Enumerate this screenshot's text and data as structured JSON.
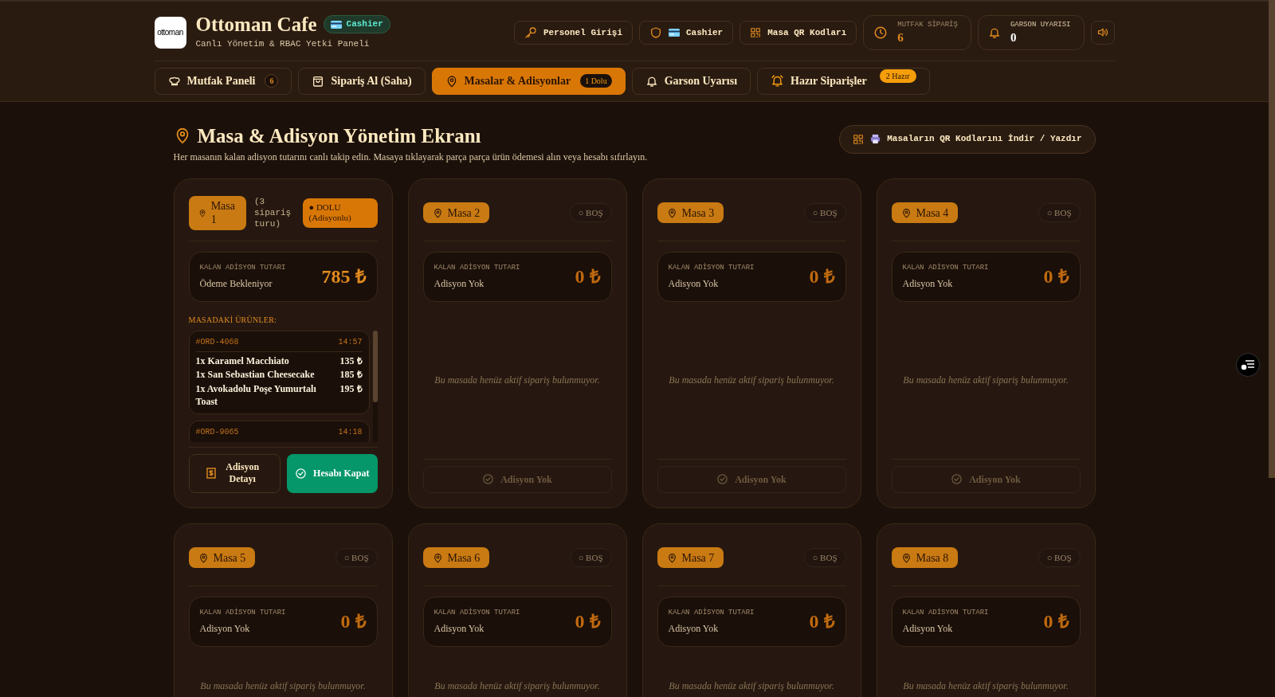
{
  "header": {
    "logo_text": "ottoman",
    "title": "Ottoman Cafe",
    "role_badge": "Cashier",
    "subtitle": "Canlı Yönetim & RBAC Yetki Paneli",
    "actions": [
      {
        "kind": "key",
        "label": "Personel Girişi"
      },
      {
        "kind": "role",
        "label": "Cashier"
      },
      {
        "kind": "qr",
        "label": "Masa QR Kodları"
      }
    ],
    "stats": [
      {
        "kind": "clock",
        "label": "MUTFAK SİPARİŞ",
        "value": "6"
      },
      {
        "kind": "bell",
        "label": "GARSON UYARISI",
        "value": "0"
      }
    ]
  },
  "tabs": [
    {
      "kind": "kitchen",
      "label": "Mutfak Paneli",
      "badge": "6",
      "selected": false
    },
    {
      "kind": "order",
      "label": "Sipariş Al (Saha)",
      "selected": false
    },
    {
      "kind": "tables",
      "label": "Masalar & Adisyonlar",
      "badge": "1 Dolu",
      "selected": true
    },
    {
      "kind": "waiter",
      "label": "Garson Uyarısı",
      "selected": false
    },
    {
      "kind": "ready",
      "label": "Hazır Siparişler",
      "badge": "2 Hazır",
      "selected": false
    }
  ],
  "page": {
    "title": "Masa & Adisyon Yönetim Ekranı",
    "description": "Her masanın kalan adisyon tutarını canlı takip edin. Masaya tıklayarak parça parça ürün ödemesi alın veya hesabı sıfırlayın.",
    "qr_button": "Masaların QR Kodlarını İndir / Yazdır"
  },
  "tables": [
    {
      "name": "Masa 1",
      "kind": "occupied",
      "status_label": "● DOLU (Adisyonlu)",
      "rounds": "(3 sipariş turu)",
      "amount_label": "KALAN ADİSYON TUTARI",
      "amount_note": "Ödeme Bekleniyor",
      "amount": "785 ₺",
      "items_heading": "MASADAKİ ÜRÜNLER:",
      "orders": [
        {
          "id": "#ORD-4068",
          "time": "14:57",
          "items": [
            {
              "name": "1x Karamel Macchiato",
              "price": "135 ₺"
            },
            {
              "name": "1x San Sebastian Cheesecake",
              "price": "185 ₺"
            },
            {
              "name": "1x Avokadolu Poşe Yumurtalı Toast",
              "price": "195 ₺"
            }
          ]
        },
        {
          "id": "#ORD-9065",
          "time": "14:18"
        }
      ],
      "actions": [
        {
          "kind": "detail",
          "label": "Adisyon Detayı"
        },
        {
          "kind": "close",
          "label": "Hesabı Kapat"
        }
      ]
    },
    {
      "name": "Masa 2",
      "kind": "empty",
      "status_label": "○ BOŞ",
      "amount_label": "KALAN ADİSYON TUTARI",
      "amount_note": "Adisyon Yok",
      "amount": "0 ₺",
      "empty_message": "Bu masada henüz aktif sipariş bulunmuyor.",
      "actions": [
        {
          "kind": "none",
          "label": "Adisyon Yok"
        }
      ]
    },
    {
      "name": "Masa 3",
      "kind": "empty",
      "status_label": "○ BOŞ",
      "amount_label": "KALAN ADİSYON TUTARI",
      "amount_note": "Adisyon Yok",
      "amount": "0 ₺",
      "empty_message": "Bu masada henüz aktif sipariş bulunmuyor.",
      "actions": [
        {
          "kind": "none",
          "label": "Adisyon Yok"
        }
      ]
    },
    {
      "name": "Masa 4",
      "kind": "empty",
      "status_label": "○ BOŞ",
      "amount_label": "KALAN ADİSYON TUTARI",
      "amount_note": "Adisyon Yok",
      "amount": "0 ₺",
      "empty_message": "Bu masada henüz aktif sipariş bulunmuyor.",
      "actions": [
        {
          "kind": "none",
          "label": "Adisyon Yok"
        }
      ]
    },
    {
      "name": "Masa 5",
      "kind": "empty",
      "status_label": "○ BOŞ",
      "amount_label": "KALAN ADİSYON TUTARI",
      "amount_note": "Adisyon Yok",
      "amount": "0 ₺",
      "empty_message": "Bu masada henüz aktif sipariş bulunmuyor."
    },
    {
      "name": "Masa 6",
      "kind": "empty",
      "status_label": "○ BOŞ",
      "amount_label": "KALAN ADİSYON TUTARI",
      "amount_note": "Adisyon Yok",
      "amount": "0 ₺",
      "empty_message": "Bu masada henüz aktif sipariş bulunmuyor."
    },
    {
      "name": "Masa 7",
      "kind": "empty",
      "status_label": "○ BOŞ",
      "amount_label": "KALAN ADİSYON TUTARI",
      "amount_note": "Adisyon Yok",
      "amount": "0 ₺",
      "empty_message": "Bu masada henüz aktif sipariş bulunmuyor."
    },
    {
      "name": "Masa 8",
      "kind": "empty",
      "status_label": "○ BOŞ",
      "amount_label": "KALAN ADİSYON TUTARI",
      "amount_note": "Adisyon Yok",
      "amount": "0 ₺",
      "empty_message": "Bu masada henüz aktif sipariş bulunmuyor."
    }
  ]
}
